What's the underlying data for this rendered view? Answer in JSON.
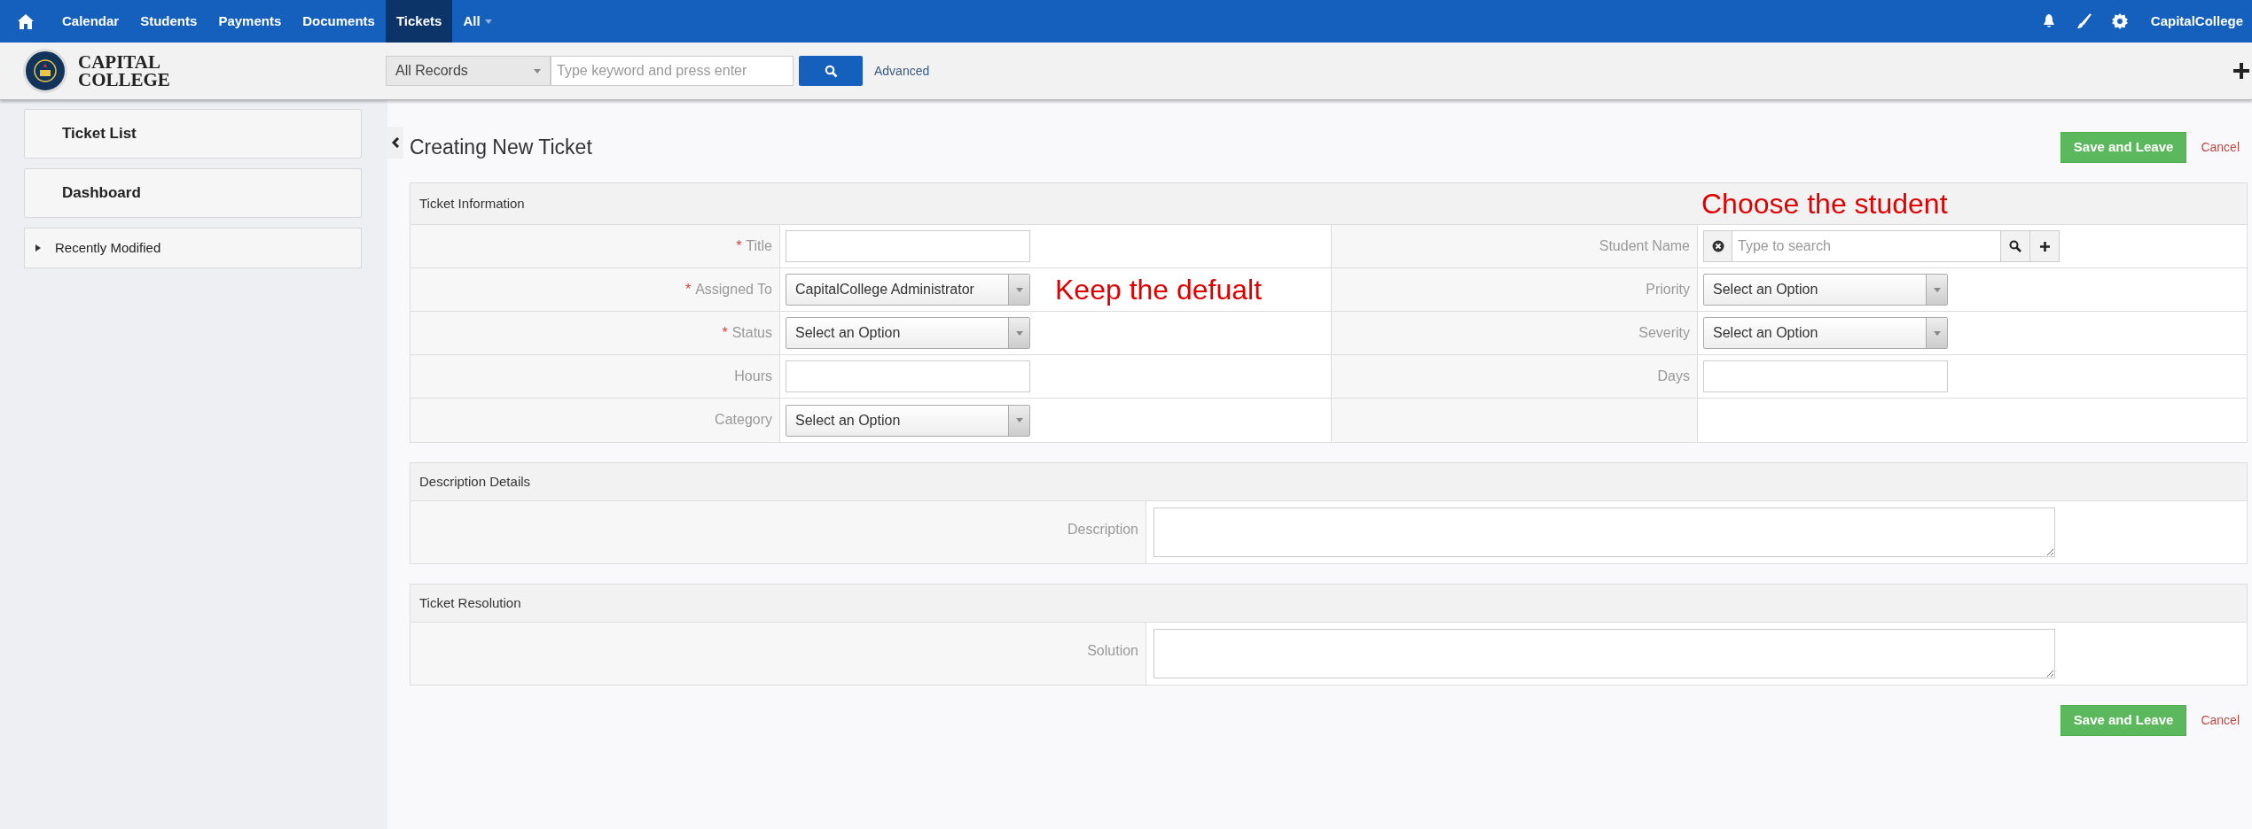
{
  "nav": {
    "items": [
      {
        "label": "Calendar",
        "selected": false,
        "dropdown": false
      },
      {
        "label": "Students",
        "selected": false,
        "dropdown": false
      },
      {
        "label": "Payments",
        "selected": false,
        "dropdown": false
      },
      {
        "label": "Documents",
        "selected": false,
        "dropdown": false
      },
      {
        "label": "Tickets",
        "selected": true,
        "dropdown": false
      },
      {
        "label": "All",
        "selected": false,
        "dropdown": true
      }
    ],
    "user": "CapitalCollege"
  },
  "header": {
    "logo_lines": [
      "CAPITAL",
      "COLLEGE"
    ],
    "search_scope": "All Records",
    "search": {
      "placeholder": "Type keyword and press enter"
    },
    "advanced": "Advanced"
  },
  "sidebar": {
    "items": [
      {
        "kind": "button",
        "label": "Ticket List"
      },
      {
        "kind": "button",
        "label": "Dashboard"
      },
      {
        "kind": "collapsible",
        "label": "Recently Modified",
        "expanded": false
      }
    ]
  },
  "page": {
    "title": "Creating New Ticket",
    "save": "Save and Leave",
    "cancel": "Cancel"
  },
  "ticket_information": {
    "title": "Ticket Information",
    "required_mark": "*",
    "note": "Choose the student",
    "rows": [
      [
        {
          "label": "Title",
          "required": true,
          "kind": "text"
        },
        {
          "label": "Student Name",
          "required": false,
          "kind": "lookup",
          "placeholder": "Type to search"
        }
      ],
      [
        {
          "label": "Assigned To",
          "required": true,
          "kind": "select",
          "value": "CapitalCollege Administrator",
          "note": "Keep the defualt"
        },
        {
          "label": "Priority",
          "required": false,
          "kind": "select",
          "value": "Select an Option"
        }
      ],
      [
        {
          "label": "Status",
          "required": true,
          "kind": "select",
          "value": "Select an Option"
        },
        {
          "label": "Severity",
          "required": false,
          "kind": "select",
          "value": "Select an Option"
        }
      ],
      [
        {
          "label": "Hours",
          "required": false,
          "kind": "text"
        },
        {
          "label": "Days",
          "required": false,
          "kind": "text"
        }
      ],
      [
        {
          "label": "Category",
          "required": false,
          "kind": "select",
          "value": "Select an Option"
        },
        {
          "kind": "empty"
        }
      ]
    ]
  },
  "text_sections": [
    {
      "title": "Description Details",
      "label": "Description"
    },
    {
      "title": "Ticket Resolution",
      "label": "Solution"
    }
  ],
  "footer": {
    "save": "Save and Leave",
    "cancel": "Cancel"
  }
}
